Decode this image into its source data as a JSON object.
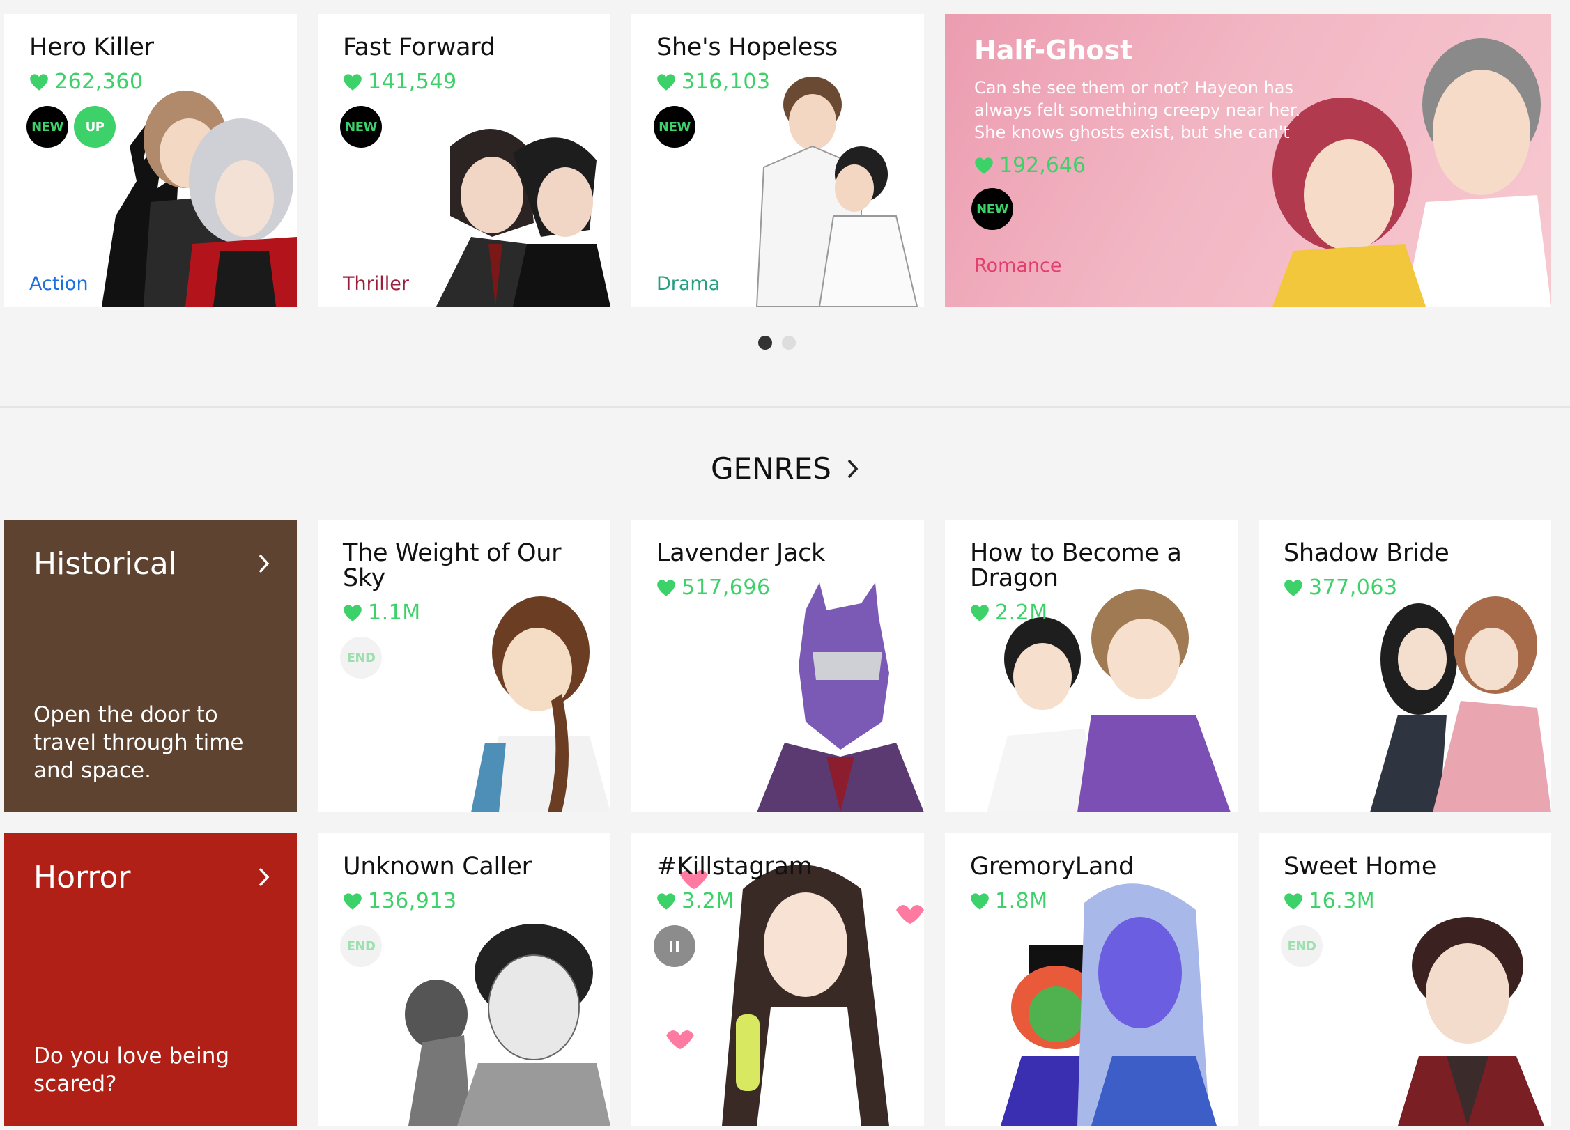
{
  "featured": [
    {
      "title": "Hero Killer",
      "likes": "262,360",
      "badges": [
        "NEW",
        "UP"
      ],
      "genre": "Action",
      "genre_color": "#1e6fe0"
    },
    {
      "title": "Fast Forward",
      "likes": "141,549",
      "badges": [
        "NEW"
      ],
      "genre": "Thriller",
      "genre_color": "#9b1d3c"
    },
    {
      "title": "She's Hopeless",
      "likes": "316,103",
      "badges": [
        "NEW"
      ],
      "genre": "Drama",
      "genre_color": "#27a082"
    }
  ],
  "hero": {
    "title": "Half-Ghost",
    "description": "Can she see them or not? Hayeon has always felt something creepy near her. She knows ghosts exist, but she can't really see them. ...",
    "likes": "192,646",
    "badge": "NEW",
    "genre": "Romance",
    "genre_color": "#e23e6e"
  },
  "carousel": {
    "pages": 2,
    "active": 1
  },
  "genres_section": {
    "title": "GENRES"
  },
  "historical": {
    "name": "Historical",
    "description": "Open the door to travel through time and space.",
    "color": "#5e4330",
    "cards": [
      {
        "title": "The Weight of Our Sky",
        "likes": "1.1M",
        "badge": "END"
      },
      {
        "title": "Lavender Jack",
        "likes": "517,696"
      },
      {
        "title": "How to Become a Dragon",
        "likes": "2.2M"
      },
      {
        "title": "Shadow Bride",
        "likes": "377,063"
      }
    ]
  },
  "horror": {
    "name": "Horror",
    "description": "Do you love being scared?",
    "color": "#b02016",
    "cards": [
      {
        "title": "Unknown Caller",
        "likes": "136,913",
        "badge": "END"
      },
      {
        "title": "#Killstagram",
        "likes": "3.2M",
        "badge": "pause"
      },
      {
        "title": "GremoryLand",
        "likes": "1.8M"
      },
      {
        "title": "Sweet Home",
        "likes": "16.3M",
        "badge": "END"
      }
    ]
  },
  "colors": {
    "accent_green": "#3dd16a",
    "background": "#f4f4f4"
  }
}
